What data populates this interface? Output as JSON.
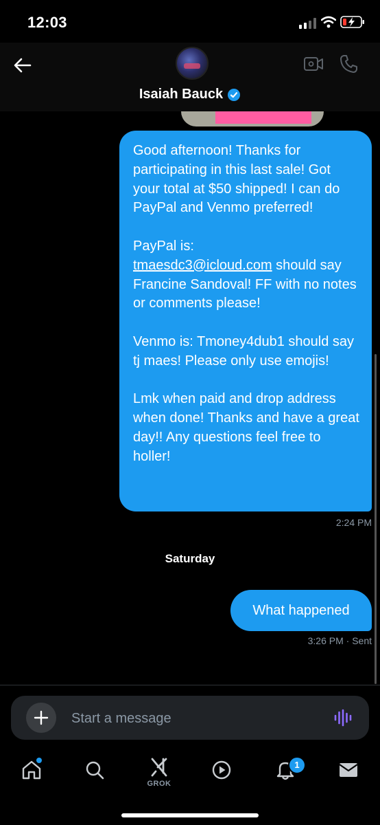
{
  "status_bar": {
    "time": "12:03"
  },
  "header": {
    "contact_name": "Isaiah Bauck"
  },
  "messages": {
    "main_text_1": "Good afternoon! Thanks for participating in this last sale! Got your total at $50 shipped! I can do PayPal and Venmo preferred!\n\nPayPal is:\n",
    "email_link": "tmaesdc3@icloud.com",
    "main_text_2": " should say Francine Sandoval! FF with no notes or comments please!\n\nVenmo is: Tmoney4dub1 should say tj maes! Please only use emojis!\n\nLmk when paid and drop address when done! Thanks and have a great day!! Any questions feel free to holler!",
    "main_time": "2:24 PM",
    "day_separator": "Saturday",
    "short_text": "What happened",
    "short_time": "3:26 PM · Sent"
  },
  "composer": {
    "placeholder": "Start a message"
  },
  "tabbar": {
    "grok_label": "GROK",
    "notification_count": "1"
  },
  "colors": {
    "accent": "#1d9bf0",
    "background": "#000000",
    "muted": "#8b98a5"
  },
  "icons": [
    "back-arrow-icon",
    "video-call-icon",
    "phone-icon",
    "verified-badge-icon",
    "plus-icon",
    "voice-waveform-icon",
    "home-icon",
    "search-icon",
    "grok-icon",
    "play-icon",
    "bell-icon",
    "mail-icon"
  ]
}
